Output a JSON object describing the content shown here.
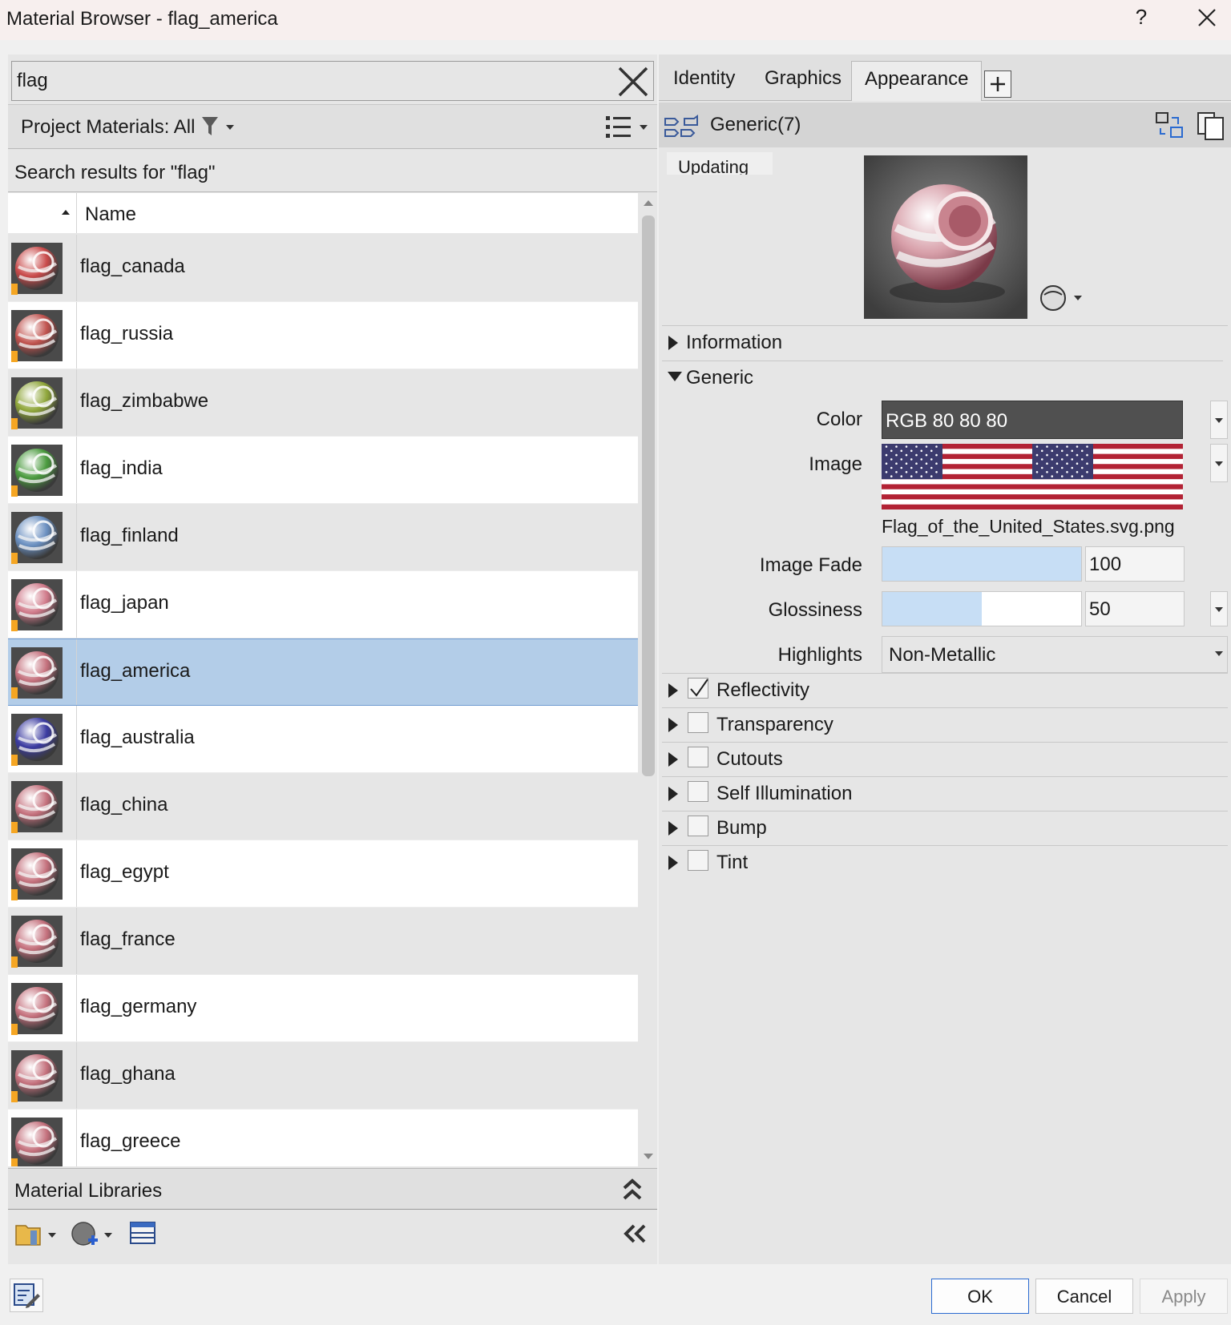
{
  "window": {
    "title": "Material Browser - flag_america",
    "help_label": "?"
  },
  "search": {
    "value": "flag"
  },
  "filter_bar": {
    "label": "Project Materials: All"
  },
  "results_header": "Search results for \"flag\"",
  "list": {
    "column_name": "Name",
    "items": [
      {
        "label": "flag_canada",
        "accent": "#c94a4a",
        "selected": false
      },
      {
        "label": "flag_russia",
        "accent": "#c0524e",
        "selected": false
      },
      {
        "label": "flag_zimbabwe",
        "accent": "#8fa63a",
        "selected": false
      },
      {
        "label": "flag_india",
        "accent": "#4a9a3e",
        "selected": false
      },
      {
        "label": "flag_finland",
        "accent": "#6a8fc0",
        "selected": false
      },
      {
        "label": "flag_japan",
        "accent": "#d07a8a",
        "selected": false
      },
      {
        "label": "flag_america",
        "accent": "#c4707c",
        "selected": true
      },
      {
        "label": "flag_australia",
        "accent": "#3a3aa0",
        "selected": false
      },
      {
        "label": "flag_china",
        "accent": "#c4707c",
        "selected": false
      },
      {
        "label": "flag_egypt",
        "accent": "#c4707c",
        "selected": false
      },
      {
        "label": "flag_france",
        "accent": "#c4707c",
        "selected": false
      },
      {
        "label": "flag_germany",
        "accent": "#c4707c",
        "selected": false
      },
      {
        "label": "flag_ghana",
        "accent": "#c4707c",
        "selected": false
      },
      {
        "label": "flag_greece",
        "accent": "#c4707c",
        "selected": false
      }
    ]
  },
  "libraries": {
    "label": "Material Libraries"
  },
  "tabs": [
    {
      "label": "Identity",
      "active": false
    },
    {
      "label": "Graphics",
      "active": false
    },
    {
      "label": "Appearance",
      "active": true
    }
  ],
  "asset": {
    "name": "Generic(7)",
    "updating_label": "Updating"
  },
  "sections": {
    "information": "Information",
    "generic": "Generic"
  },
  "generic": {
    "color_label": "Color",
    "color_value": "RGB 80 80 80",
    "image_label": "Image",
    "image_file": "Flag_of_the_United_States.svg.png",
    "image_fade_label": "Image Fade",
    "image_fade_value": "100",
    "image_fade_level": 100,
    "glossiness_label": "Glossiness",
    "glossiness_value": "50",
    "glossiness_level": 50,
    "highlights_label": "Highlights",
    "highlights_value": "Non-Metallic"
  },
  "options": [
    {
      "label": "Reflectivity",
      "checked": true
    },
    {
      "label": "Transparency",
      "checked": false
    },
    {
      "label": "Cutouts",
      "checked": false
    },
    {
      "label": "Self Illumination",
      "checked": false
    },
    {
      "label": "Bump",
      "checked": false
    },
    {
      "label": "Tint",
      "checked": false
    }
  ],
  "buttons": {
    "ok": "OK",
    "cancel": "Cancel",
    "apply": "Apply"
  },
  "colors": {
    "selection": "#b3cde8",
    "slider_fill": "#c7def5",
    "color_swatch": "#505050"
  },
  "icons": {
    "search_clear": "close-icon",
    "filter": "filter-icon",
    "view_options": "list-view-icon",
    "collapse_libraries": "double-chevron-up-icon",
    "open_library": "folder-icon",
    "create_material": "add-material-icon",
    "library_panel": "panel-icon",
    "hide_library": "double-chevron-left-icon",
    "material_editor": "edit-material-icon"
  }
}
